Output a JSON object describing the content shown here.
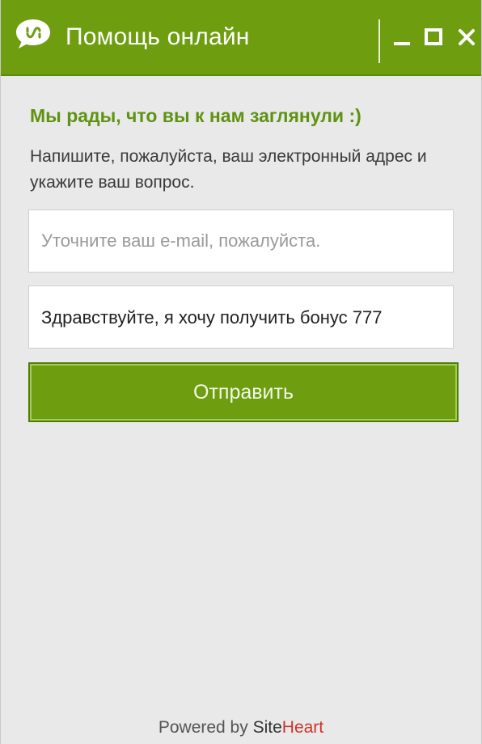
{
  "header": {
    "title": "Помощь онлайн",
    "icon": "chat-bubble-dollar-icon",
    "accent_color": "#6e9e0f",
    "window_controls": [
      "minimize-icon",
      "maximize-icon",
      "close-icon"
    ]
  },
  "body": {
    "greeting": "Мы рады, что вы к нам заглянули :)",
    "instructions": "Напишите, пожалуйста, ваш электронный адрес и укажите ваш вопрос.",
    "email_placeholder": "Уточните ваш e-mail, пожалуйста.",
    "email_value": "",
    "message_value": "Здравствуйте, я хочу получить бонус 777",
    "send_label": "Отправить"
  },
  "footer": {
    "powered_by": "Powered by",
    "brand_site": "Site",
    "brand_heart": "Heart",
    "brand_heart_color": "#d0332b"
  }
}
